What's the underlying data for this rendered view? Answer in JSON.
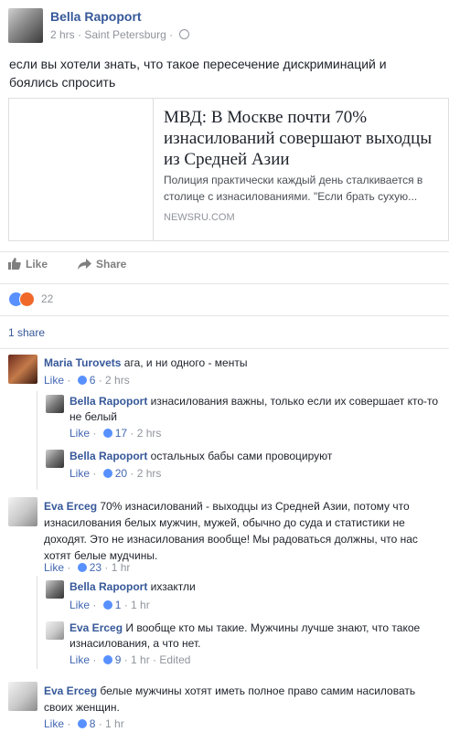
{
  "post": {
    "author": "Bella Rapoport",
    "time": "2 hrs",
    "separator": " · ",
    "location": "Saint Petersburg",
    "separator2": " · ",
    "text": "если вы хотели знать, что такое пересечение дискриминаций и боялись спросить"
  },
  "link": {
    "title": "МВД: В Москве почти 70% изнасилований совершают выходцы из Средней Азии",
    "description": "Полиция практически каждый день сталкивается в столице с изнасилованиями. \"Если брать сухую...",
    "domain": "NEWSRU.COM"
  },
  "actions": {
    "like": "Like",
    "share": "Share"
  },
  "reactions": {
    "count": "22"
  },
  "shares": "1 share",
  "comments": [
    {
      "name": "Maria Turovets",
      "text": " ага, и ни одного - менты",
      "like": "Like",
      "likes": "6",
      "time": "2 hrs"
    },
    {
      "name": "Bella Rapoport",
      "text": " изнасилования важны, только если их совершает кто-то не белый",
      "like": "Like",
      "likes": "17",
      "time": "2 hrs"
    },
    {
      "name": "Bella Rapoport",
      "text": " остальных бабы сами провоцируют",
      "like": "Like",
      "likes": "20",
      "time": "2 hrs"
    },
    {
      "name": "Eva Erceg",
      "text": " 70% изнасилований - выходцы из Средней Азии, потому что изнасилования белых мужчин, мужей, обычно до суда и статистики не доходят. Это не изнасилования вообще! Мы радоваться должны, что нас хотят белые мудчины.",
      "like": "Like",
      "likes": "23",
      "time": "1 hr"
    },
    {
      "name": "Bella Rapoport",
      "text": " ихзактли",
      "like": "Like",
      "likes": "1",
      "time": "1 hr"
    },
    {
      "name": "Eva Erceg",
      "text": " И вообще кто мы такие. Мужчины лучше знают, что такое изнасилования, а что нет.",
      "like": "Like",
      "likes": "9",
      "time": "1 hr · Edited"
    },
    {
      "name": "Eva Erceg",
      "text": " белые мужчины хотят иметь полное право самим насиловать своих женщин.",
      "like": "Like",
      "likes": "8",
      "time": "1 hr"
    }
  ],
  "dot": " · ",
  "colors": {
    "link": "#365899",
    "muted": "#90949c",
    "like_blue": "#5890ff"
  }
}
